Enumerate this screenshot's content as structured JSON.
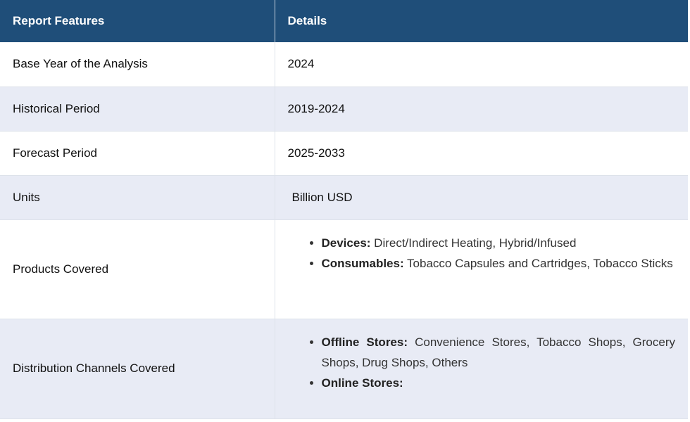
{
  "header": {
    "col1": "Report Features",
    "col2": "Details"
  },
  "rows": [
    {
      "feature": "Base Year of the Analysis",
      "detail": "2024"
    },
    {
      "feature": "Historical Period",
      "detail": "2019-2024"
    },
    {
      "feature": "Forecast Period",
      "detail": "2025-2033"
    },
    {
      "feature": "Units",
      "detail": "Billion USD"
    },
    {
      "feature": "Products Covered",
      "items": [
        {
          "label": "Devices:",
          "text": " Direct/Indirect Heating, Hybrid/Infused"
        },
        {
          "label": "Consumables:",
          "text": " Tobacco Capsules and Cartridges, Tobacco Sticks"
        }
      ]
    },
    {
      "feature": "Distribution Channels Covered",
      "items": [
        {
          "label": "Offline Stores:",
          "text": " Convenience Stores, Tobacco Shops, Grocery Shops, Drug Shops, Others"
        },
        {
          "label": "Online Stores:",
          "text": ""
        }
      ]
    }
  ],
  "colors": {
    "header_bg": "#1f4e79",
    "alt_row_bg": "#e8ebf5"
  }
}
